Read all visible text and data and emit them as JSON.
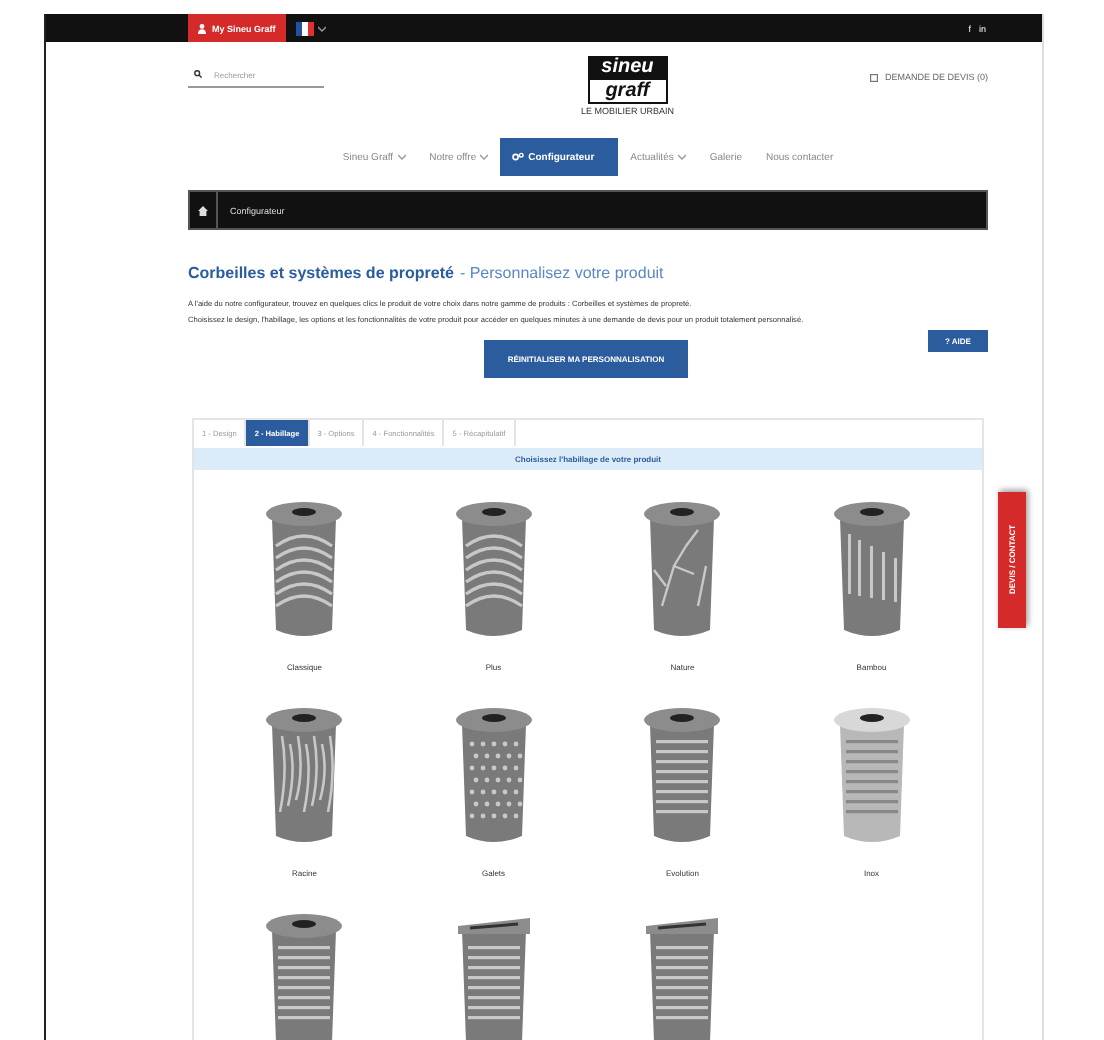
{
  "topbar": {
    "account": "My Sineu Graff",
    "social": [
      "f",
      "in"
    ]
  },
  "header": {
    "search": {
      "placeholder": "Rechercher"
    },
    "logo": {
      "line1": "sineu",
      "line2": "graff",
      "tagline": "LE MOBILIER URBAIN"
    },
    "quote": "DEMANDE DE DEVIS (0)"
  },
  "nav": [
    {
      "label": "Sineu Graff",
      "dropdown": true,
      "selected": false
    },
    {
      "label": "Notre offre",
      "dropdown": true,
      "selected": false
    },
    {
      "label": "Configurateur",
      "dropdown": false,
      "selected": true
    },
    {
      "label": "Actualités",
      "dropdown": true,
      "selected": false
    },
    {
      "label": "Galerie",
      "dropdown": false,
      "selected": false
    },
    {
      "label": "Nous contacter",
      "dropdown": false,
      "selected": false
    }
  ],
  "breadcrumb": "Configurateur",
  "title": {
    "main": "Corbeilles et systèmes de propreté",
    "sub": "- Personnalisez votre produit"
  },
  "intro": [
    "A l'aide du notre configurateur, trouvez en quelques clics le produit de votre choix dans notre gamme de produits : Corbeilles et systèmes de propreté.",
    "Choisissez le design, l'habillage, les options et les fonctionnalités de votre produit pour accéder en quelques minutes à une demande de devis pour un produit totalement personnalisé."
  ],
  "help_button": "? AIDE",
  "reset_button": "RÉINITIALISER MA PERSONNALISATION",
  "steps": [
    {
      "label": "1 - Design",
      "selected": false
    },
    {
      "label": "2 - Habillage",
      "selected": true
    },
    {
      "label": "3 - Options",
      "selected": false
    },
    {
      "label": "4 - Fonctionnalités",
      "selected": false
    },
    {
      "label": "5 - Récapitulatif",
      "selected": false
    }
  ],
  "panel_heading": "Choisissez l'habillage de votre produit",
  "products": [
    {
      "name": "Classique",
      "kind": "arches"
    },
    {
      "name": "Plus",
      "kind": "arches"
    },
    {
      "name": "Nature",
      "kind": "branches"
    },
    {
      "name": "Bambou",
      "kind": "bars"
    },
    {
      "name": "Racine",
      "kind": "leaves"
    },
    {
      "name": "Galets",
      "kind": "dots"
    },
    {
      "name": "Evolution",
      "kind": "rings"
    },
    {
      "name": "Inox",
      "kind": "steel"
    },
    {
      "kind": "rings"
    },
    {
      "kind": "flap"
    },
    {
      "kind": "flap"
    }
  ],
  "side_tab": "DEVIS / CONTACT"
}
